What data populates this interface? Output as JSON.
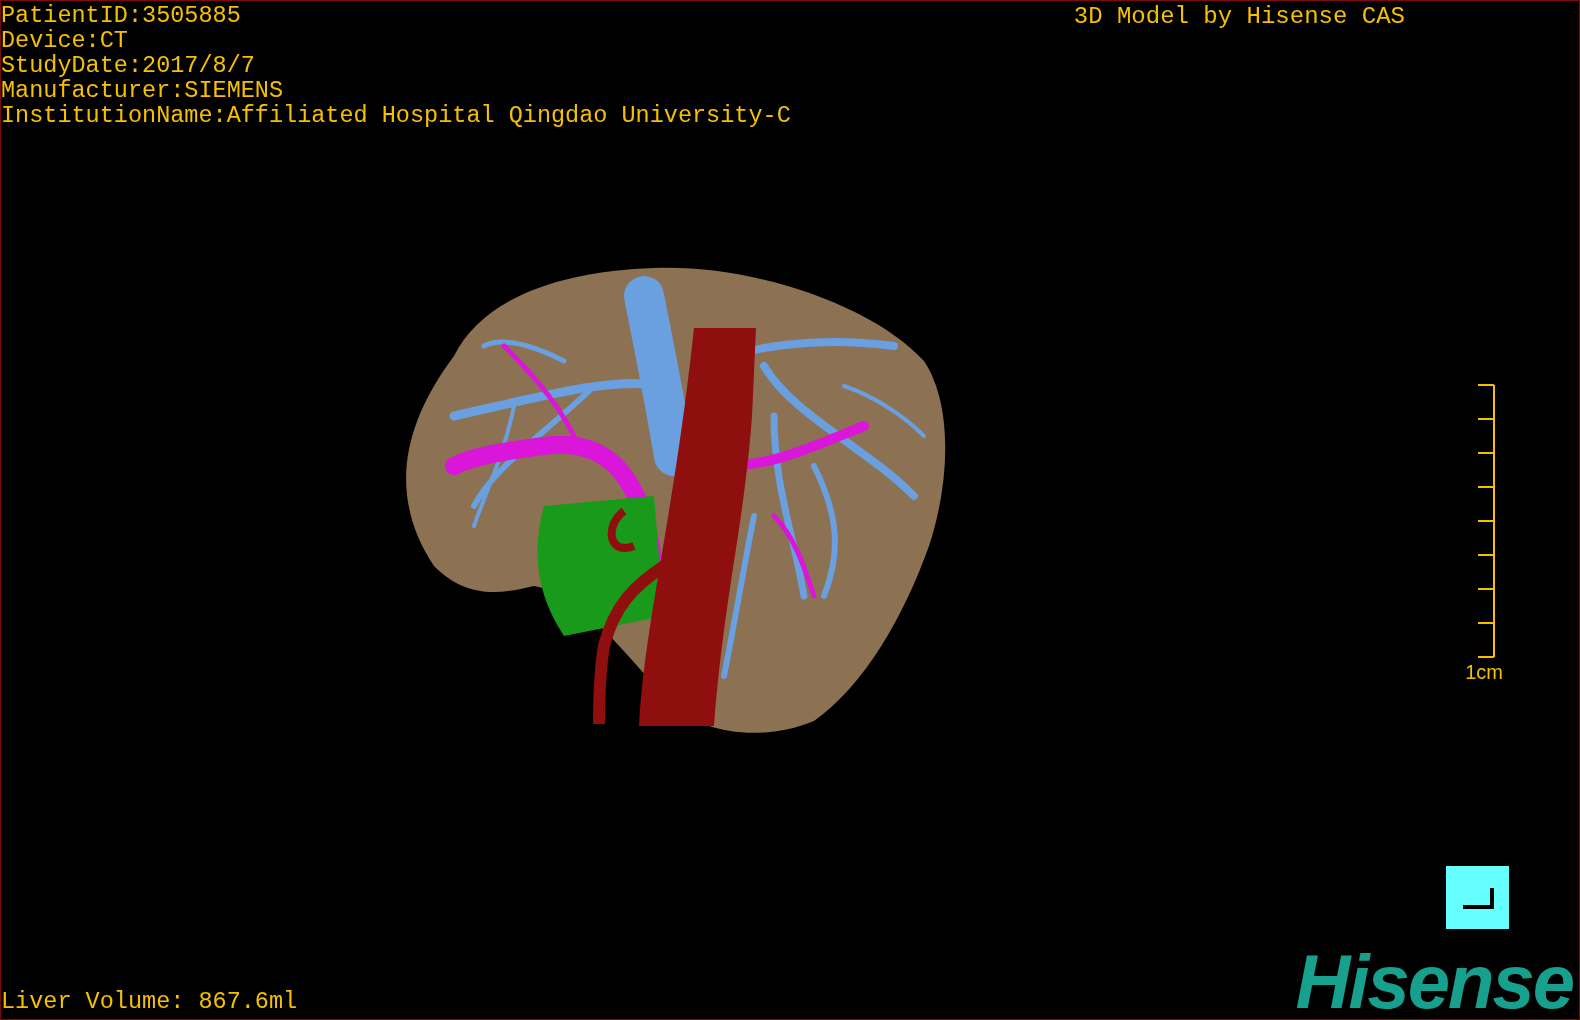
{
  "study_info": [
    "PatientID:3505885",
    "Device:CT",
    "StudyDate:2017/8/7",
    "Manufacturer:SIEMENS",
    "InstitutionName:Affiliated Hospital Qingdao University-C"
  ],
  "model_credit": "3D Model by Hisense CAS",
  "scale": {
    "label": "1cm"
  },
  "liver_volume": "Liver Volume: 867.6ml",
  "logo": "Hisense"
}
